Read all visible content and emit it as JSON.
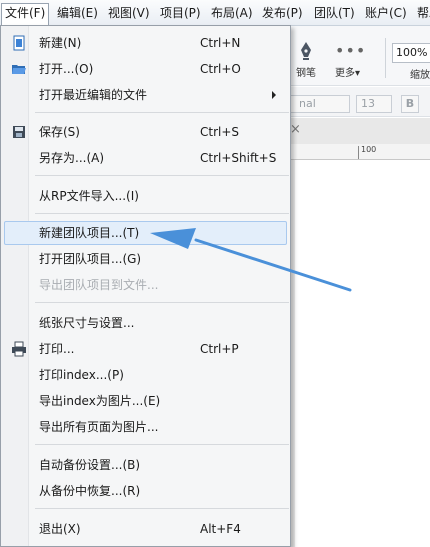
{
  "menubar": {
    "items": [
      {
        "label": "文件(F)"
      },
      {
        "label": "编辑(E)"
      },
      {
        "label": "视图(V)"
      },
      {
        "label": "项目(P)"
      },
      {
        "label": "布局(A)"
      },
      {
        "label": "发布(P)"
      },
      {
        "label": "团队(T)"
      },
      {
        "label": "账户(C)"
      },
      {
        "label": "帮助"
      }
    ]
  },
  "toolbar": {
    "pen_label": "钢笔",
    "more_label": "更多▾",
    "zoom_value": "100%",
    "zoom_label": "缩放"
  },
  "formatbar": {
    "font_value": "nal",
    "size_value": "13",
    "bold_label": "B"
  },
  "ruler": {
    "mark": "100"
  },
  "file_menu": {
    "items": [
      {
        "label": "新建(N)",
        "shortcut": "Ctrl+N"
      },
      {
        "label": "打开...(O)",
        "shortcut": "Ctrl+O"
      },
      {
        "label": "打开最近编辑的文件",
        "shortcut": ""
      },
      {
        "label": "保存(S)",
        "shortcut": "Ctrl+S"
      },
      {
        "label": "另存为...(A)",
        "shortcut": "Ctrl+Shift+S"
      },
      {
        "label": "从RP文件导入...(I)",
        "shortcut": ""
      },
      {
        "label": "新建团队项目...(T)",
        "shortcut": ""
      },
      {
        "label": "打开团队项目...(G)",
        "shortcut": ""
      },
      {
        "label": "导出团队项目到文件...",
        "shortcut": ""
      },
      {
        "label": "纸张尺寸与设置...",
        "shortcut": ""
      },
      {
        "label": "打印...",
        "shortcut": "Ctrl+P"
      },
      {
        "label": "打印index...(P)",
        "shortcut": ""
      },
      {
        "label": "导出index为图片...(E)",
        "shortcut": ""
      },
      {
        "label": "导出所有页面为图片...",
        "shortcut": ""
      },
      {
        "label": "自动备份设置...(B)",
        "shortcut": ""
      },
      {
        "label": "从备份中恢复...(R)",
        "shortcut": ""
      },
      {
        "label": "退出(X)",
        "shortcut": "Alt+F4"
      }
    ]
  },
  "colors": {
    "highlight_bg": "#e3eefa",
    "highlight_border": "#a9c9ee",
    "annotation_arrow": "#4a90d9"
  }
}
